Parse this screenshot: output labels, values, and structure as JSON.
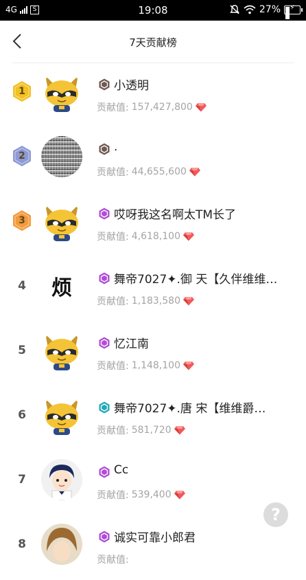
{
  "status_bar": {
    "network": "4G",
    "sim_icon": "S",
    "time": "19:08",
    "battery": "27%"
  },
  "header": {
    "title": "7天贡献榜"
  },
  "ranking": [
    {
      "rank": "1",
      "medal": "gold",
      "level_badge": "brown",
      "avatar": "raccoon",
      "name": "小透明",
      "label": "贡献值:",
      "value": "157,427,800"
    },
    {
      "rank": "2",
      "medal": "silver",
      "level_badge": "brown",
      "avatar": "static",
      "name": ".",
      "label": "贡献值:",
      "value": "44,655,600"
    },
    {
      "rank": "3",
      "medal": "bronze",
      "level_badge": "purple",
      "avatar": "raccoon",
      "name": "哎呀我这名啊太TM长了",
      "label": "贡献值:",
      "value": "4,618,100"
    },
    {
      "rank": "4",
      "medal": "",
      "level_badge": "purple",
      "avatar": "char",
      "avatar_text": "烦",
      "name": "舞帝7027✦.御 天【久伴维维…",
      "label": "贡献值:",
      "value": "1,183,580"
    },
    {
      "rank": "5",
      "medal": "",
      "level_badge": "purple",
      "avatar": "raccoon",
      "name": "忆江南",
      "label": "贡献值:",
      "value": "1,148,100"
    },
    {
      "rank": "6",
      "medal": "",
      "level_badge": "teal",
      "avatar": "raccoon",
      "name": "舞帝7027✦.唐 宋【维维爵…",
      "label": "贡献值:",
      "value": "581,720"
    },
    {
      "rank": "7",
      "medal": "",
      "level_badge": "purple",
      "avatar": "cartoon",
      "name": "Cc",
      "label": "贡献值:",
      "value": "539,400"
    },
    {
      "rank": "8",
      "medal": "",
      "level_badge": "purple",
      "avatar": "hair",
      "name": "诚实可靠小郎君",
      "label": "贡献值:",
      "value": ""
    }
  ],
  "help_button": {
    "label": "?"
  },
  "colors": {
    "gem": "#f05a5a",
    "label_gray": "#a4a4a4",
    "gold": "#f2c020",
    "silver": "#8d9ad6",
    "bronze": "#f39a3c",
    "lvl_brown": "#6f5a52",
    "lvl_purple": "#b04ed6",
    "lvl_teal": "#22a9b7"
  }
}
